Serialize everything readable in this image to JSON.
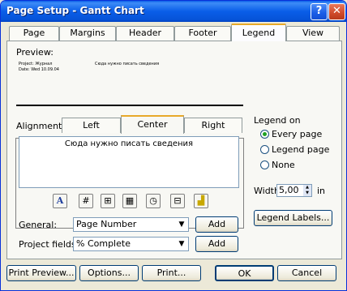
{
  "window": {
    "title": "Page Setup - Gantt Chart",
    "help_glyph": "?",
    "close_glyph": "✕"
  },
  "tabs": [
    {
      "label": "Page"
    },
    {
      "label": "Margins"
    },
    {
      "label": "Header"
    },
    {
      "label": "Footer"
    },
    {
      "label": "Legend"
    },
    {
      "label": "View"
    }
  ],
  "preview": {
    "label": "Preview:",
    "small_left_line1": "Project: Журнал",
    "small_left_line2": "Date: Wed 10.09.04",
    "small_center": "Сюда нужно писать сведения"
  },
  "alignment": {
    "label": "Alignment:",
    "tabs": [
      {
        "label": "Left"
      },
      {
        "label": "Center"
      },
      {
        "label": "Right"
      }
    ],
    "text": "Сюда нужно писать сведения"
  },
  "format_icons": [
    {
      "name": "font-icon",
      "glyph": "A"
    },
    {
      "name": "page-number-icon",
      "glyph": "#"
    },
    {
      "name": "total-pages-icon",
      "glyph": "⊞"
    },
    {
      "name": "date-icon",
      "glyph": "▦"
    },
    {
      "name": "time-icon",
      "glyph": "◷"
    },
    {
      "name": "file-name-icon",
      "glyph": "⊟"
    },
    {
      "name": "insert-picture-icon",
      "glyph": "▟"
    }
  ],
  "general": {
    "label": "General:",
    "value": "Page Number",
    "add_label": "Add"
  },
  "project_fields": {
    "label": "Project fields:",
    "value": "% Complete",
    "add_label": "Add"
  },
  "legend_on": {
    "label": "Legend on",
    "options": [
      {
        "label": "Every page",
        "selected": true
      },
      {
        "label": "Legend page",
        "selected": false
      },
      {
        "label": "None",
        "selected": false
      }
    ]
  },
  "width": {
    "label": "Width:",
    "value": "5,00",
    "unit": "in"
  },
  "legend_labels_button": "Legend Labels...",
  "footer_buttons": {
    "print_preview": "Print Preview...",
    "options": "Options...",
    "print": "Print...",
    "ok": "OK",
    "cancel": "Cancel"
  },
  "colors": {
    "title_bar": "#0a5ee8",
    "selected_tab_accent": "#e8a92a",
    "dialog_bg": "#ece9d8"
  }
}
